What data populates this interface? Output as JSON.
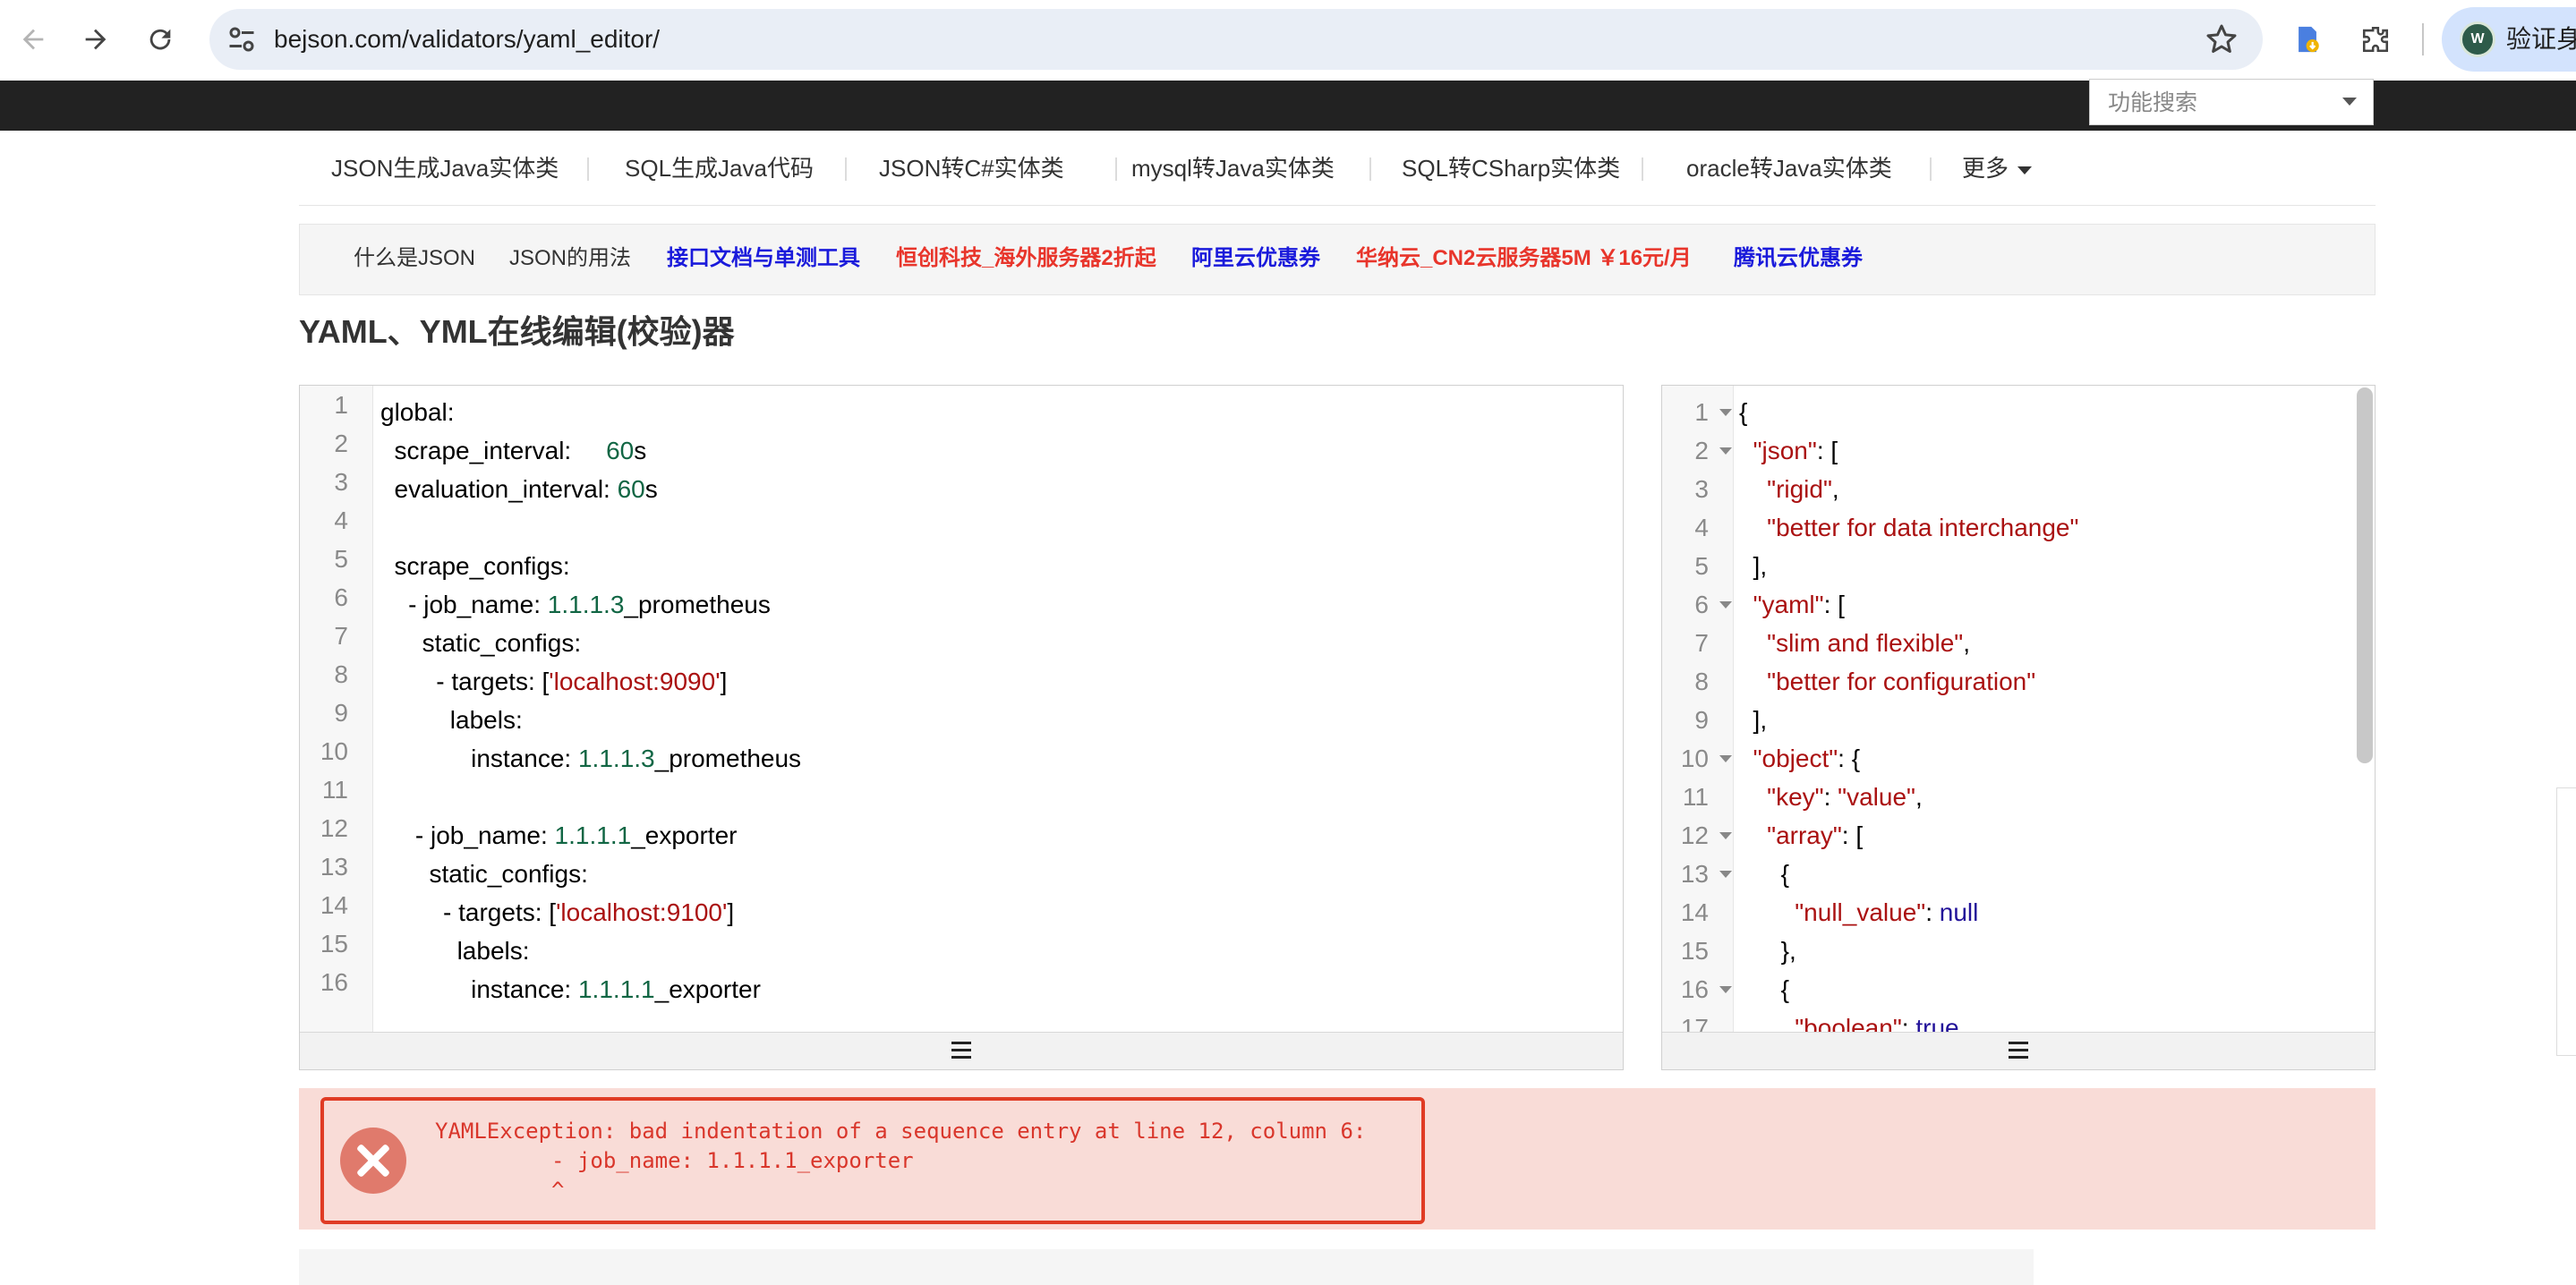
{
  "browser": {
    "url": "bejson.com/validators/yaml_editor/",
    "profile_label": "验证身",
    "profile_initial": "W"
  },
  "site": {
    "function_search_placeholder": "功能搜索",
    "nav_items": [
      "JSON生成Java实体类",
      "SQL生成Java代码",
      "JSON转C#实体类",
      "mysql转Java实体类",
      "SQL转CSharp实体类",
      "oracle转Java实体类",
      "更多"
    ],
    "links": [
      {
        "text": "什么是JSON",
        "color": "#333333"
      },
      {
        "text": "JSON的用法",
        "color": "#333333"
      },
      {
        "text": "接口文档与单测工具",
        "color": "#1a1adb"
      },
      {
        "text": "恒创科技_海外服务器2折起",
        "color": "#e8352b"
      },
      {
        "text": "阿里云优惠券",
        "color": "#1a1adb"
      },
      {
        "text": "华纳云_CN2云服务器5M ￥16元/月",
        "color": "#e8352b"
      },
      {
        "text": "腾讯云优惠券",
        "color": "#1a1adb"
      }
    ],
    "page_title": "YAML、YML在线编辑(校验)器"
  },
  "yaml_editor": {
    "line_numbers": [
      "1",
      "2",
      "3",
      "4",
      "5",
      "6",
      "7",
      "8",
      "9",
      "10",
      "11",
      "12",
      "13",
      "14",
      "15",
      "16"
    ]
  },
  "json_editor": {
    "line_numbers": [
      "1",
      "2",
      "3",
      "4",
      "5",
      "6",
      "7",
      "8",
      "9",
      "10",
      "11",
      "12",
      "13",
      "14",
      "15",
      "16",
      "17"
    ]
  },
  "error": {
    "message": "YAMLException: bad indentation of a sequence entry at line 12, column 6:\n         - job_name: 1.1.1.1_exporter\n         ^"
  },
  "colors": {
    "number": "#116644",
    "string": "#aa1111",
    "keyword": "#221199",
    "error": "#d9362b"
  }
}
